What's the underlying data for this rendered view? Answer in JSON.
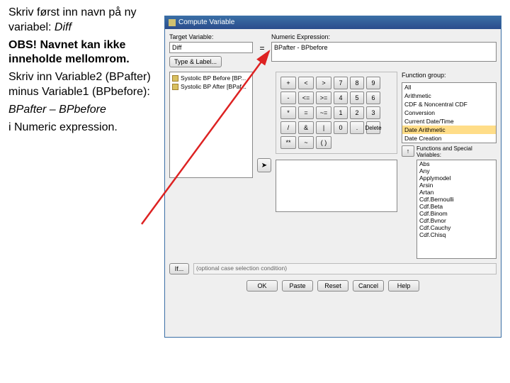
{
  "instructions": {
    "p1a": "Skriv først inn navn på ny variabel: ",
    "p1b": "Diff",
    "p2": "OBS! Navnet kan ikke inneholde mellomrom.",
    "p3": "Skriv inn Variable2 (BPafter) minus Variable1 (BPbefore):",
    "p4": "BPafter – BPbefore",
    "p5": "i Numeric expression."
  },
  "dialog": {
    "title": "Compute Variable",
    "target_label": "Target Variable:",
    "target_value": "Diff",
    "type_label_btn": "Type & Label...",
    "expr_label": "Numeric Expression:",
    "expr_value": "BPafter - BPbefore",
    "vars": [
      "Systolic BP Before [BP...",
      "Systolic BP After [BPaf..."
    ],
    "keypad_ops": [
      "+",
      "<",
      ">",
      "-",
      "<=",
      ">=",
      "*",
      "=",
      "~=",
      "/",
      "&",
      "|",
      "**",
      "~",
      "( )"
    ],
    "keypad_nums": [
      "7",
      "8",
      "9",
      "4",
      "5",
      "6",
      "1",
      "2",
      "3",
      "0",
      "."
    ],
    "delete_btn": "Delete",
    "fgroup_label": "Function group:",
    "fgroups": [
      "All",
      "Arithmetic",
      "CDF & Noncentral CDF",
      "Conversion",
      "Current Date/Time",
      "Date Arithmetic",
      "Date Creation"
    ],
    "fgroup_selected_index": 5,
    "funcs_label": "Functions and Special Variables:",
    "funcs": [
      "Abs",
      "Any",
      "Applymodel",
      "Arsin",
      "Artan",
      "Cdf.Bernoulli",
      "Cdf.Beta",
      "Cdf.Binom",
      "Cdf.Bvnor",
      "Cdf.Cauchy",
      "Cdf.Chisq"
    ],
    "if_btn": "If...",
    "if_text": "(optional case selection condition)",
    "buttons": [
      "OK",
      "Paste",
      "Reset",
      "Cancel",
      "Help"
    ]
  }
}
